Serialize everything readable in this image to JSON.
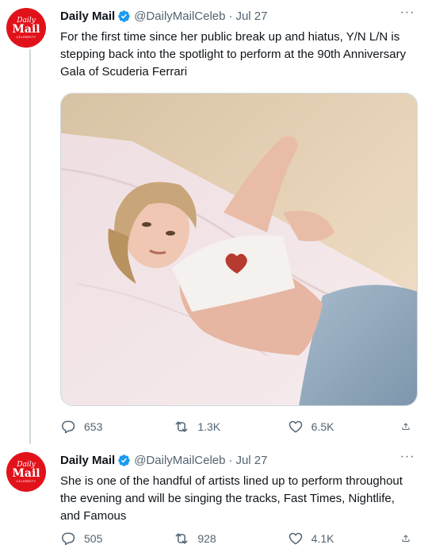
{
  "tweets": [
    {
      "author": {
        "name": "Daily Mail",
        "handle": "@DailyMailCeleb",
        "avatar_lines": [
          "Daily",
          "Mail",
          "CELEBRITY"
        ]
      },
      "date": "Jul 27",
      "text": "For the first time since her public break up and hiatus, Y/N L/N is stepping back into the spotlight to perform at the 90th Anniversary Gala of Scuderia Ferrari",
      "media": {
        "description": "photo"
      },
      "stats": {
        "replies": "653",
        "retweets": "1.3K",
        "likes": "6.5K"
      }
    },
    {
      "author": {
        "name": "Daily Mail",
        "handle": "@DailyMailCeleb",
        "avatar_lines": [
          "Daily",
          "Mail",
          "CELEBRITY"
        ]
      },
      "date": "Jul 27",
      "text": "She is one of the handful of artists lined up to perform throughout the evening and will be singing the tracks, Fast Times, Nightlife, and Famous",
      "stats": {
        "replies": "505",
        "retweets": "928",
        "likes": "4.1K"
      }
    }
  ],
  "separator": "·",
  "more_label": "···",
  "colors": {
    "brand": "#e2121b",
    "verified": "#1d9bf0",
    "muted": "#536471",
    "text": "#0f1419",
    "line": "#cfd9de"
  },
  "icons": [
    "reply-icon",
    "retweet-icon",
    "like-icon",
    "share-icon",
    "verified-badge-icon",
    "more-icon"
  ]
}
